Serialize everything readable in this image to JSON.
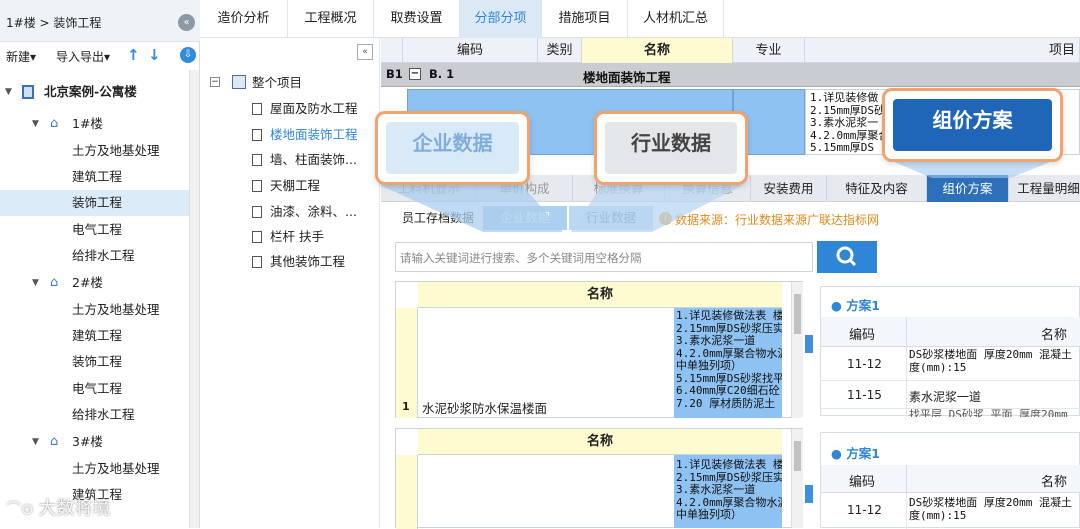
{
  "breadcrumb": "1#楼 > 装饰工程",
  "toolbar": {
    "new": "新建▾",
    "import_export": "导入导出▾"
  },
  "tree": {
    "project": "北京案例-公寓楼",
    "buildings": [
      {
        "name": "1#楼",
        "items": [
          "土方及地基处理",
          "建筑工程",
          "装饰工程",
          "电气工程",
          "给排水工程"
        ]
      },
      {
        "name": "2#楼",
        "items": [
          "土方及地基处理",
          "建筑工程",
          "装饰工程",
          "电气工程",
          "给排水工程"
        ]
      },
      {
        "name": "3#楼",
        "items": [
          "土方及地基处理",
          "建筑工程"
        ]
      }
    ],
    "selected": "装饰工程"
  },
  "tabs": [
    "造价分析",
    "工程概况",
    "取费设置",
    "分部分项",
    "措施项目",
    "人材机汇总"
  ],
  "active_tab": "分部分项",
  "project_tree": {
    "root": "整个项目",
    "items": [
      "屋面及防水工程",
      "楼地面装饰工程",
      "墙、柱面装饰...",
      "天棚工程",
      "油漆、涂料、...",
      "栏杆 扶手",
      "其他装饰工程"
    ]
  },
  "grid": {
    "headers": [
      "编码",
      "类别",
      "名称",
      "专业",
      "项目"
    ],
    "b1_row": {
      "id": "B1",
      "code": "B. 1",
      "name": "楼地面装饰工程"
    },
    "desc_lines": [
      "1.详见装修做",
      "2.15mm厚DS砂",
      "3.素水泥浆一",
      "4.2.0mm厚聚合",
      "5.15mm厚DS"
    ]
  },
  "lower_tabs": [
    "工料机显示",
    "单价构成",
    "标准换算",
    "换算信息",
    "安装费用",
    "特征及内容",
    "组价方案",
    "工程量明细"
  ],
  "sub_tabs": [
    "员工存档数据",
    "企业数据",
    "行业数据"
  ],
  "source_note": "数据来源：行业数据来源广联达指标网",
  "search_placeholder": "请输入关键词进行搜索、多个关键词用空格分隔",
  "list_header": "名称",
  "list_item": {
    "num": "1",
    "name": "水泥砂浆防水保温楼面",
    "desc": [
      "1.详见装修做法表 楼",
      "2.15mm厚DS砂浆压实",
      "3.素水泥浆一道",
      "4.2.0mm厚聚合物水泥",
      "中单独列项）",
      "5.15mm厚DS砂浆找平",
      "6.40mm厚C20细石砼",
      "7.20   厚材质防泥土"
    ]
  },
  "list_item_2": {
    "desc": [
      "1.详见装修做法表 楼",
      "2.15mm厚DS砂浆压实",
      "3.素水泥浆一道",
      "4.2.0mm厚聚合物水泥",
      "中单独列项）"
    ]
  },
  "plan1": {
    "title": "方案1",
    "headers": [
      "编码",
      "名称"
    ],
    "rows": [
      {
        "code": "11-12",
        "name": "DS砂浆楼地面 厚度20mm 混凝土",
        "name2": "度(mm):15"
      },
      {
        "code": "11-15",
        "name": "素水泥浆一道"
      },
      {
        "code": "",
        "name": "找平层 DS砂浆 平面 厚度20mm"
      }
    ]
  },
  "plan2": {
    "title": "方案1",
    "headers": [
      "编码",
      "名称"
    ],
    "rows": [
      {
        "code": "11-12",
        "name": "DS砂浆楼地面 厚度20mm 混凝土",
        "name2": "度(mm):15"
      }
    ]
  },
  "callouts": {
    "enterprise": "企业数据",
    "industry": "行业数据",
    "pricing": "组价方案"
  },
  "watermark": "大数将境",
  "colors": {
    "accent": "#2f86d6",
    "callout_border": "#f0a36e",
    "selected_tab": "#2d6fb8",
    "highlight_yellow": "#fffbd0"
  }
}
